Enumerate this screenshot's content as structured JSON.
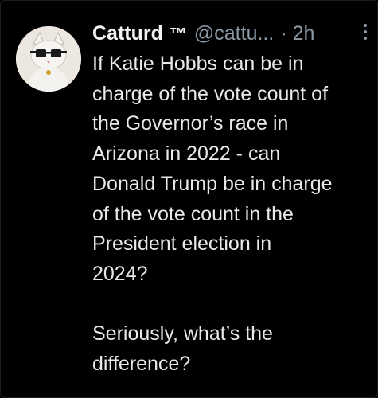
{
  "tweet": {
    "author": {
      "name": "Catturd",
      "badge": "™",
      "handle": "@cattu...",
      "avatar_icon": "cat-avatar-icon"
    },
    "separator": "·",
    "timestamp": "2h",
    "menu_icon": "more-vertical-icon",
    "text_lines": [
      "If Katie Hobbs can be in",
      "charge of the vote count of",
      "the Governor’s race in",
      "Arizona in 2022 - can",
      "Donald Trump be in charge",
      "of the vote count in the",
      "President election in",
      "2024?",
      "",
      "Seriously, what’s the",
      "difference?"
    ]
  },
  "colors": {
    "background": "#000000",
    "text": "#e7e9ea",
    "secondary_text": "#8b98a5"
  }
}
